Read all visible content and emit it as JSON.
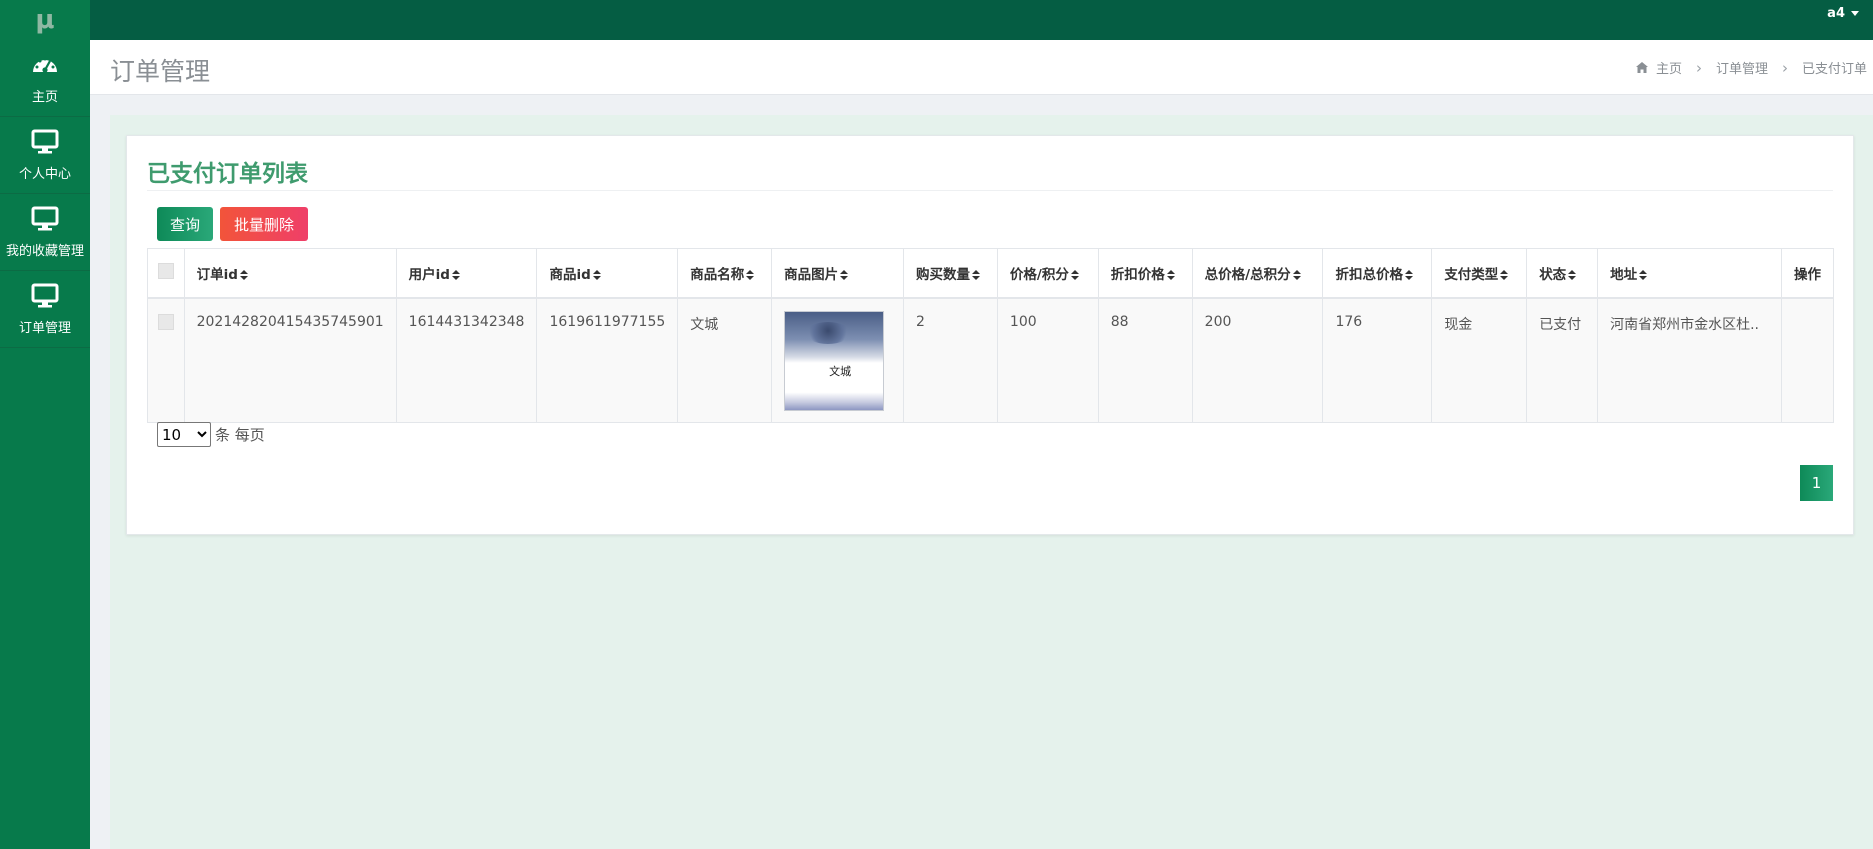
{
  "app": {
    "logo": "μ",
    "user": "a4"
  },
  "sidebar": {
    "items": [
      {
        "label": "主页",
        "icon": "dashboard-icon"
      },
      {
        "label": "个人中心",
        "icon": "monitor-icon"
      },
      {
        "label": "我的收藏管理",
        "icon": "monitor-icon"
      },
      {
        "label": "订单管理",
        "icon": "monitor-icon"
      }
    ]
  },
  "header": {
    "title": "订单管理",
    "breadcrumb": [
      "主页",
      "订单管理",
      "已支付订单"
    ]
  },
  "card": {
    "title": "已支付订单列表",
    "buttons": {
      "query": "查询",
      "batch_delete": "批量删除"
    }
  },
  "table": {
    "columns": [
      "订单id",
      "用户id",
      "商品id",
      "商品名称",
      "商品图片",
      "购买数量",
      "价格/积分",
      "折扣价格",
      "总价格/总积分",
      "折扣总价格",
      "支付类型",
      "状态",
      "地址",
      "操作"
    ],
    "rows": [
      {
        "order_id": "20214282041543574590​1",
        "user_id": "1614431342348",
        "product_id": "1619611977155",
        "product_name": "文城",
        "image_title": "文城",
        "quantity": "2",
        "price": "100",
        "discount_price": "88",
        "total_price": "200",
        "discount_total": "176",
        "pay_type": "现金",
        "status": "已支付",
        "address": "河南省郑州市金水区杜..",
        "action": ""
      }
    ]
  },
  "pagination": {
    "page_size": "10",
    "page_size_options": [
      "10"
    ],
    "page_size_suffix": "条 每页",
    "current_page": "1"
  },
  "colors": {
    "topbar": "#055d43",
    "sidebar": "#077a4b",
    "accent": "#3f9b6e",
    "danger": "#f2543a"
  }
}
